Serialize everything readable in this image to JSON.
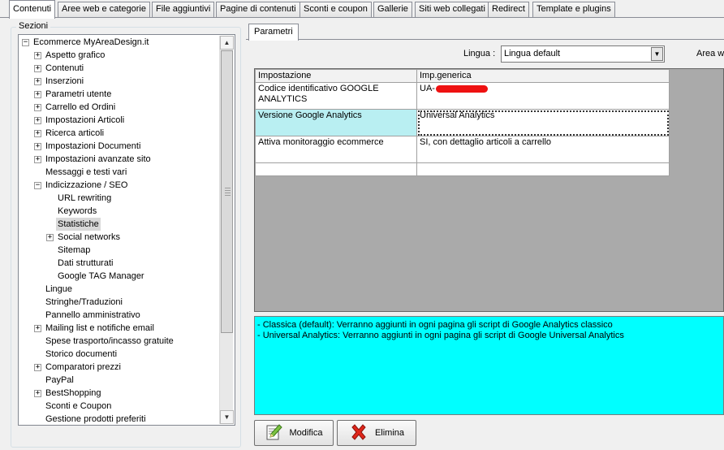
{
  "tabs": [
    {
      "label": "Contenuti",
      "active": true
    },
    {
      "label": "Aree web e categorie",
      "active": false
    },
    {
      "label": "File aggiuntivi",
      "active": false
    },
    {
      "label": "Pagine di contenuti",
      "active": false
    },
    {
      "label": "Sconti e coupon",
      "active": false
    },
    {
      "label": "Gallerie",
      "active": false
    },
    {
      "label": "Siti web collegati",
      "active": false
    },
    {
      "label": "Redirect",
      "active": false
    },
    {
      "label": "Template e plugins",
      "active": false
    }
  ],
  "sidebar": {
    "caption": "Sezioni",
    "tree": [
      {
        "label": "Ecommerce MyAreaDesign.it",
        "level": 0,
        "expander": "minus"
      },
      {
        "label": "Aspetto grafico",
        "level": 1,
        "expander": "plus"
      },
      {
        "label": "Contenuti",
        "level": 1,
        "expander": "plus"
      },
      {
        "label": "Inserzioni",
        "level": 1,
        "expander": "plus"
      },
      {
        "label": "Parametri utente",
        "level": 1,
        "expander": "plus"
      },
      {
        "label": "Carrello ed Ordini",
        "level": 1,
        "expander": "plus"
      },
      {
        "label": "Impostazioni Articoli",
        "level": 1,
        "expander": "plus"
      },
      {
        "label": "Ricerca articoli",
        "level": 1,
        "expander": "plus"
      },
      {
        "label": "Impostazioni Documenti",
        "level": 1,
        "expander": "plus"
      },
      {
        "label": "Impostazioni avanzate sito",
        "level": 1,
        "expander": "plus"
      },
      {
        "label": "Messaggi e testi vari",
        "level": 1,
        "expander": ""
      },
      {
        "label": "Indicizzazione / SEO",
        "level": 1,
        "expander": "minus"
      },
      {
        "label": "URL rewriting",
        "level": 2,
        "expander": ""
      },
      {
        "label": "Keywords",
        "level": 2,
        "expander": ""
      },
      {
        "label": "Statistiche",
        "level": 2,
        "expander": "",
        "selected": true
      },
      {
        "label": "Social networks",
        "level": 2,
        "expander": "plus"
      },
      {
        "label": "Sitemap",
        "level": 2,
        "expander": ""
      },
      {
        "label": "Dati strutturati",
        "level": 2,
        "expander": ""
      },
      {
        "label": "Google TAG Manager",
        "level": 2,
        "expander": ""
      },
      {
        "label": "Lingue",
        "level": 1,
        "expander": ""
      },
      {
        "label": "Stringhe/Traduzioni",
        "level": 1,
        "expander": ""
      },
      {
        "label": "Pannello amministrativo",
        "level": 1,
        "expander": ""
      },
      {
        "label": "Mailing list e notifiche email",
        "level": 1,
        "expander": "plus"
      },
      {
        "label": "Spese trasporto/incasso gratuite",
        "level": 1,
        "expander": ""
      },
      {
        "label": "Storico documenti",
        "level": 1,
        "expander": ""
      },
      {
        "label": "Comparatori prezzi",
        "level": 1,
        "expander": "plus"
      },
      {
        "label": "PayPal",
        "level": 1,
        "expander": ""
      },
      {
        "label": "BestShopping",
        "level": 1,
        "expander": "plus"
      },
      {
        "label": "Sconti e Coupon",
        "level": 1,
        "expander": ""
      },
      {
        "label": "Gestione prodotti preferiti",
        "level": 1,
        "expander": ""
      }
    ]
  },
  "main": {
    "tab_label": "Parametri",
    "lingua_label": "Lingua :",
    "lingua_value": "Lingua default",
    "area_label": "Area w",
    "grid": {
      "columns": [
        "Impostazione",
        "Imp.generica"
      ],
      "rows": [
        {
          "setting": "Codice identificativo GOOGLE ANALYTICS",
          "value": "UA-",
          "redacted": true,
          "selected": false
        },
        {
          "setting": "Versione Google Analytics",
          "value": "Universal Analytics",
          "redacted": false,
          "selected": true
        },
        {
          "setting": "Attiva monitoraggio ecommerce",
          "value": "SI, con dettaglio articoli a carrello",
          "redacted": false,
          "selected": false
        },
        {
          "setting": "",
          "value": "",
          "redacted": false,
          "selected": false
        }
      ]
    },
    "description": [
      "- Classica (default): Verranno aggiunti in ogni pagina gli script di Google Analytics classico",
      "- Universal Analytics: Verranno aggiunti in ogni pagina gli script di Google Universal Analytics"
    ],
    "buttons": {
      "edit": "Modifica",
      "delete": "Elimina"
    }
  },
  "colors": {
    "description_bg": "#00ffff",
    "selected_cell_bg": "#b9eff2",
    "grid_empty_bg": "#aaaaaa",
    "redaction": "#ee1111"
  }
}
